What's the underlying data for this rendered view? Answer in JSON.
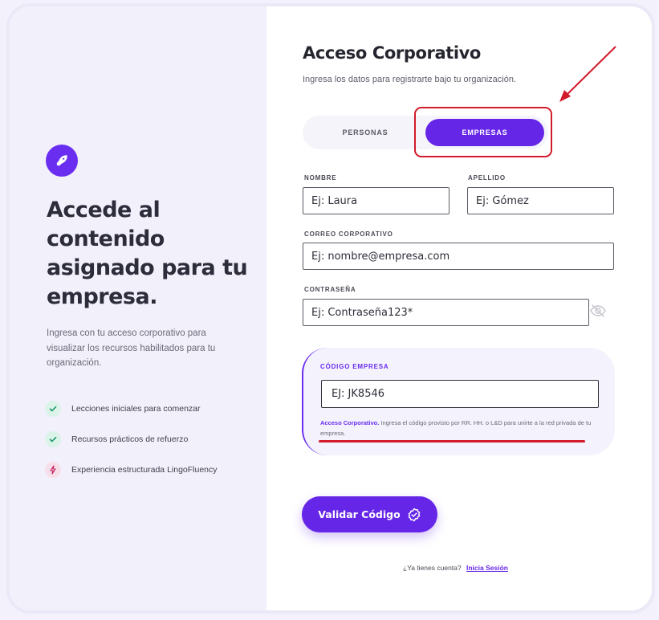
{
  "left": {
    "title": "Accede al contenido asignado para tu empresa.",
    "description": "Ingresa con tu acceso corporativo para visualizar los recursos habilitados para tu organización.",
    "features": [
      {
        "icon": "check-icon",
        "label": "Lecciones iniciales para comenzar"
      },
      {
        "icon": "check-icon",
        "label": "Recursos prácticos de refuerzo"
      },
      {
        "icon": "bolt-icon",
        "label": "Experiencia estructurada LingoFluency"
      }
    ]
  },
  "form": {
    "title": "Acceso Corporativo",
    "subtitle": "Ingresa los datos para registrarte bajo tu organización.",
    "toggle": {
      "personas": "PERSONAS",
      "empresas": "EMPRESAS",
      "selected": "EMPRESAS"
    },
    "nombre": {
      "label": "NOMBRE",
      "placeholder": "Ej: Laura"
    },
    "apellido": {
      "label": "APELLIDO",
      "placeholder": "Ej: Gómez"
    },
    "correo": {
      "label": "CORREO CORPORATIVO",
      "placeholder": "Ej: nombre@empresa.com"
    },
    "password": {
      "label": "CONTRASEÑA",
      "placeholder": "Ej: Contraseña123*"
    },
    "codigo": {
      "label": "CÓDIGO EMPRESA",
      "value": "EJ: JK8546",
      "note_bold": "Acceso Corporativo.",
      "note_text": " Ingresa el código provisto por RR. HH. o L&D para unirte a la red privada de tu empresa."
    },
    "validate_button": "Validar Código",
    "login_prompt": "¿Ya tienes cuenta?",
    "login_link": "Inicia Sesión"
  },
  "colors": {
    "accent": "#6626e8",
    "annotation": "#d21a2a"
  }
}
